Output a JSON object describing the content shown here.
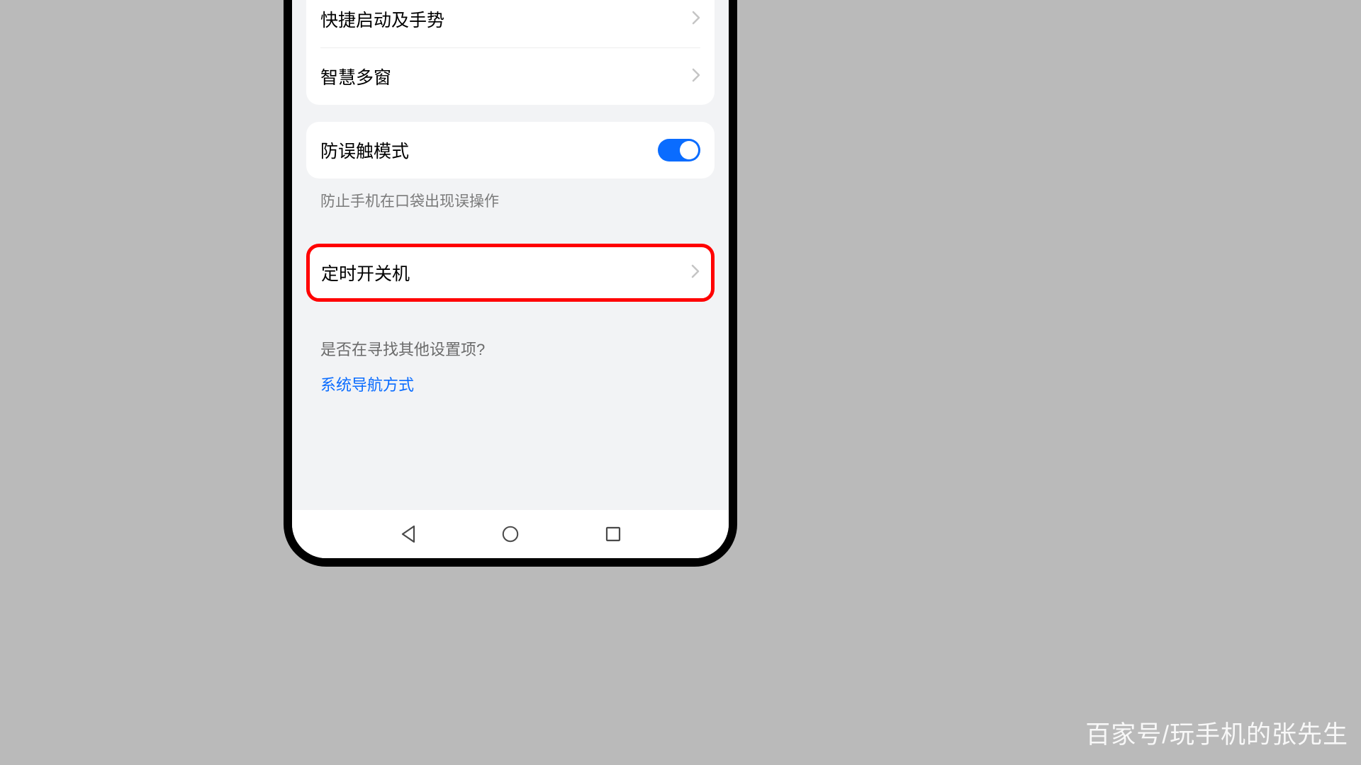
{
  "settings": {
    "group1": {
      "item1_label": "快捷启动及手势",
      "item2_label": "智慧多窗"
    },
    "group2": {
      "toggle_label": "防误触模式",
      "toggle_on": true,
      "helper_text": "防止手机在口袋出现误操作"
    },
    "group3": {
      "highlighted_label": "定时开关机"
    },
    "footer": {
      "question": "是否在寻找其他设置项?",
      "link": "系统导航方式"
    }
  },
  "watermark": "百家号/玩手机的张先生"
}
